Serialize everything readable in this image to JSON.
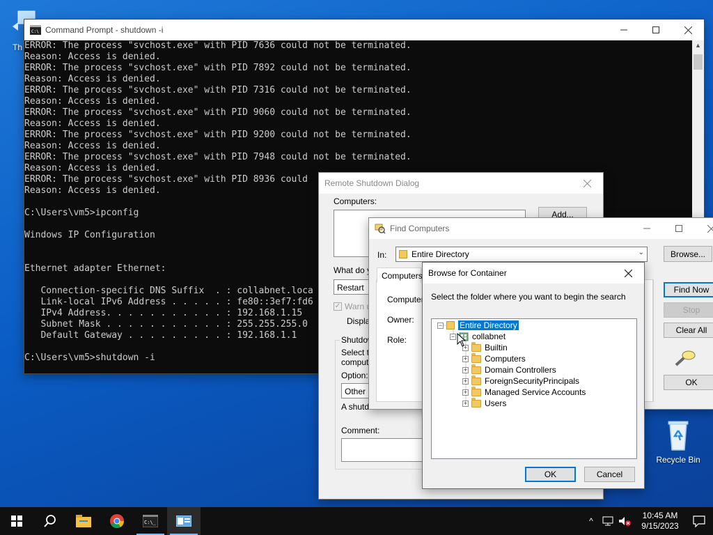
{
  "desktop": {
    "icons": [
      {
        "name": "Th"
      },
      {
        "name": "Recycle Bin"
      }
    ]
  },
  "cmd": {
    "title": "Command Prompt - shutdown  -i",
    "lines": [
      "ERROR: The process \"svchost.exe\" with PID 7636 could not be terminated.",
      "Reason: Access is denied.",
      "ERROR: The process \"svchost.exe\" with PID 7892 could not be terminated.",
      "Reason: Access is denied.",
      "ERROR: The process \"svchost.exe\" with PID 7316 could not be terminated.",
      "Reason: Access is denied.",
      "ERROR: The process \"svchost.exe\" with PID 9060 could not be terminated.",
      "Reason: Access is denied.",
      "ERROR: The process \"svchost.exe\" with PID 9200 could not be terminated.",
      "Reason: Access is denied.",
      "ERROR: The process \"svchost.exe\" with PID 7948 could not be terminated.",
      "Reason: Access is denied.",
      "ERROR: The process \"svchost.exe\" with PID 8936 could",
      "Reason: Access is denied.",
      "",
      "C:\\Users\\vm5>ipconfig",
      "",
      "Windows IP Configuration",
      "",
      "",
      "Ethernet adapter Ethernet:",
      "",
      "   Connection-specific DNS Suffix  . : collabnet.loca",
      "   Link-local IPv6 Address . . . . . : fe80::3ef7:fd6",
      "   IPv4 Address. . . . . . . . . . . : 192.168.1.15",
      "   Subnet Mask . . . . . . . . . . . : 255.255.255.0",
      "   Default Gateway . . . . . . . . . : 192.168.1.1",
      "",
      "C:\\Users\\vm5>shutdown -i"
    ]
  },
  "remote_shutdown": {
    "title": "Remote Shutdown Dialog",
    "computers_label": "Computers:",
    "add_label": "Add...",
    "what_do_label": "What do y",
    "action_value": "Restart",
    "warn_label": "Warn u",
    "display_label": "Display",
    "shutdown_group_label": "Shutdow",
    "select_text_1": "Select th",
    "select_text_2": "compute",
    "option_label": "Option:",
    "option_value": "Other (F",
    "shutdown_text": "A shutdo",
    "comment_label": "Comment:"
  },
  "find_computers": {
    "title": "Find Computers",
    "in_label": "In:",
    "in_value": "Entire Directory",
    "browse_label": "Browse...",
    "tab_label": "Computers",
    "computer_name_label": "Computer n",
    "owner_label": "Owner:",
    "role_label": "Role:",
    "find_now_label": "Find Now",
    "stop_label": "Stop",
    "clear_all_label": "Clear All",
    "ok_label": "OK"
  },
  "browse": {
    "title": "Browse for Container",
    "instruction": "Select the folder where you want to begin the search",
    "tree": {
      "root": "Entire Directory",
      "domain": "collabnet",
      "children": [
        "Builtin",
        "Computers",
        "Domain Controllers",
        "ForeignSecurityPrincipals",
        "Managed Service Accounts",
        "Users"
      ]
    },
    "ok_label": "OK",
    "cancel_label": "Cancel"
  },
  "taskbar": {
    "time": "10:45 AM",
    "date": "9/15/2023"
  }
}
